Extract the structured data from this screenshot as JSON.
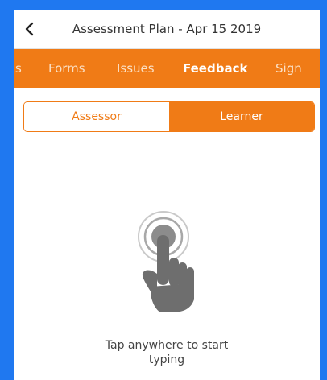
{
  "header": {
    "title": "Assessment Plan - Apr 15 2019",
    "back_icon": "chevron-left-icon"
  },
  "tabs": [
    {
      "label": "s",
      "active": false
    },
    {
      "label": "Forms",
      "active": false
    },
    {
      "label": "Issues",
      "active": false
    },
    {
      "label": "Feedback",
      "active": true
    },
    {
      "label": "Sign",
      "active": false
    }
  ],
  "segments": {
    "left": "Assessor",
    "right": "Learner",
    "selected": "Learner"
  },
  "empty_state": {
    "icon": "tap-hand-icon",
    "line1": "Tap anywhere to start",
    "line2": "typing"
  },
  "colors": {
    "accent": "#f07b16",
    "frame": "#1f78f0",
    "icon_gray": "#6e6e6e"
  }
}
